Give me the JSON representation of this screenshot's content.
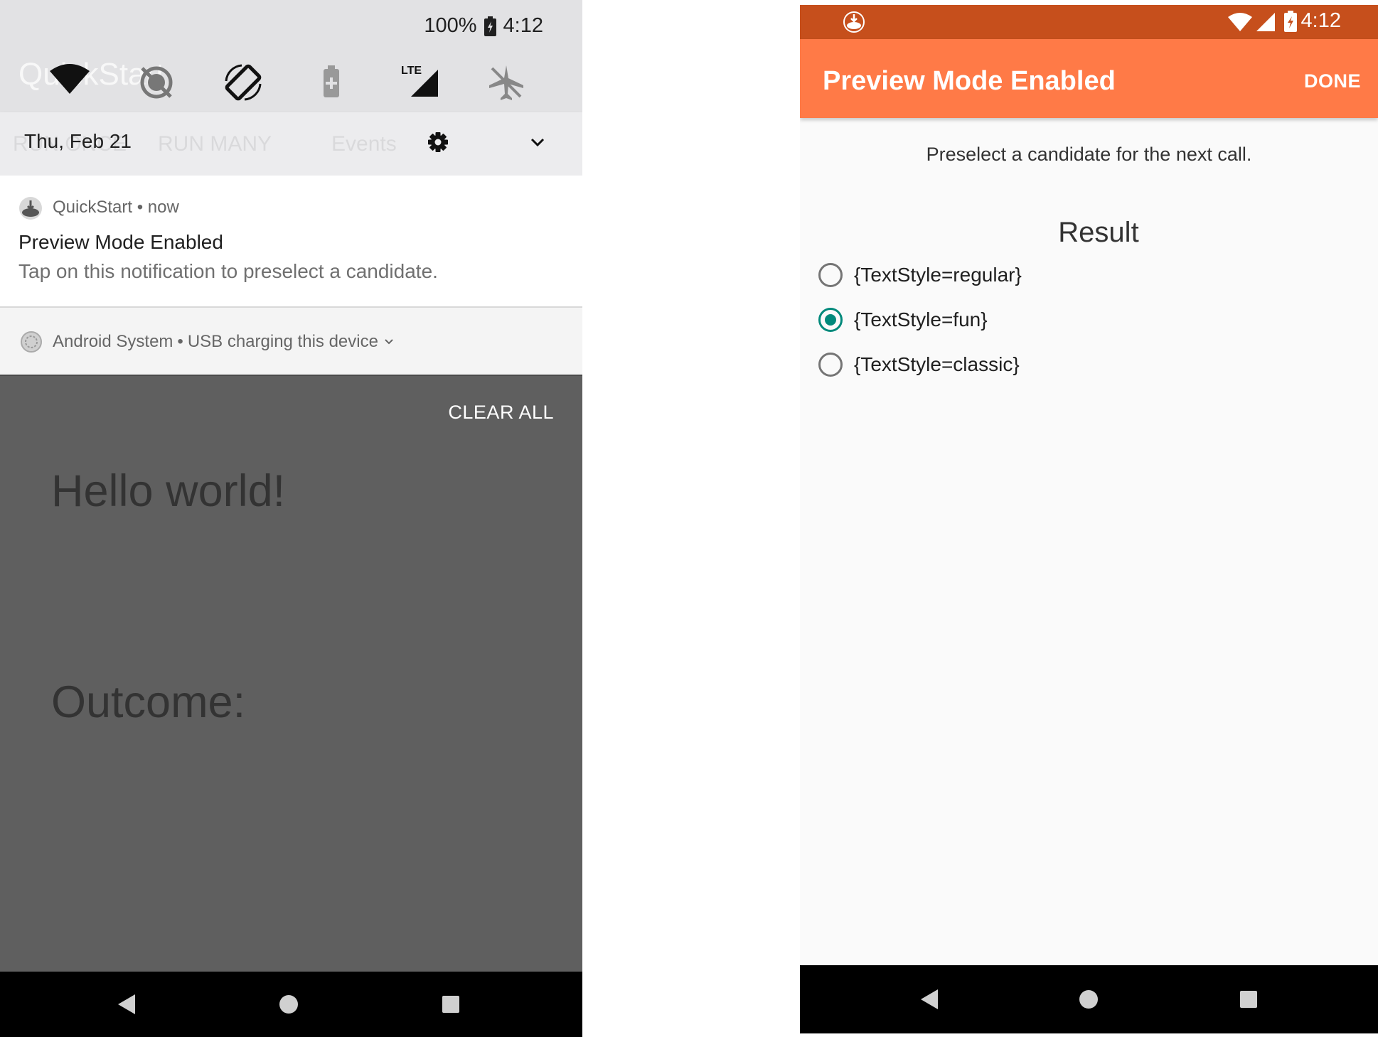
{
  "left_screen": {
    "status": {
      "battery": "100%",
      "time": "4:12"
    },
    "background_title": "QuickStart",
    "background_tabs": [
      "RUN ONCE",
      "RUN MANY",
      "Events"
    ],
    "date": "Thu, Feb 21",
    "quick_settings_icons": [
      "wifi-icon",
      "data-saver-icon",
      "auto-rotate-icon",
      "battery-saver-icon",
      "lte-signal-icon",
      "airplane-mode-icon"
    ],
    "notification_quickstart": {
      "app": "QuickStart",
      "time": "now",
      "title": "Preview Mode Enabled",
      "text": "Tap on this notification to preselect a candidate."
    },
    "notification_system": {
      "app": "Android System",
      "text": "USB charging this device"
    },
    "clear_all": "CLEAR ALL",
    "app_hello": "Hello world!",
    "app_outcome": "Outcome:"
  },
  "right_screen": {
    "status": {
      "time": "4:12"
    },
    "appbar_title": "Preview Mode Enabled",
    "done_label": "DONE",
    "prompt": "Preselect a candidate for the next call.",
    "result_heading": "Result",
    "options": [
      {
        "label": "{TextStyle=regular}",
        "checked": false
      },
      {
        "label": "{TextStyle=fun}",
        "checked": true
      },
      {
        "label": "{TextStyle=classic}",
        "checked": false
      }
    ]
  },
  "colors": {
    "status_bar": "#c64f1c",
    "app_bar": "#ff7a47",
    "radio_accent": "#00897b"
  }
}
